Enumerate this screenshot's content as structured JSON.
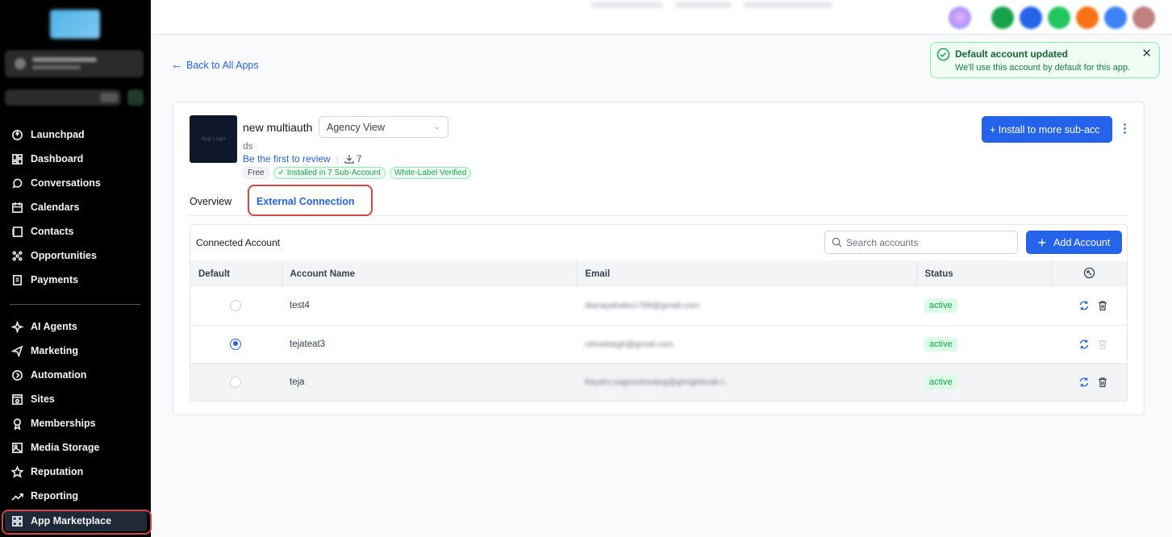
{
  "sidebar": {
    "nav_top": [
      {
        "label": "Launchpad",
        "icon": "rocket-icon"
      },
      {
        "label": "Dashboard",
        "icon": "dashboard-icon"
      },
      {
        "label": "Conversations",
        "icon": "chat-icon"
      },
      {
        "label": "Calendars",
        "icon": "calendar-icon"
      },
      {
        "label": "Contacts",
        "icon": "contacts-icon"
      },
      {
        "label": "Opportunities",
        "icon": "opportunities-icon"
      },
      {
        "label": "Payments",
        "icon": "payments-icon"
      }
    ],
    "nav_bottom": [
      {
        "label": "AI Agents",
        "icon": "sparkle-icon"
      },
      {
        "label": "Marketing",
        "icon": "send-icon"
      },
      {
        "label": "Automation",
        "icon": "automation-icon"
      },
      {
        "label": "Sites",
        "icon": "sites-icon"
      },
      {
        "label": "Memberships",
        "icon": "award-icon"
      },
      {
        "label": "Media Storage",
        "icon": "image-icon"
      },
      {
        "label": "Reputation",
        "icon": "star-icon"
      },
      {
        "label": "Reporting",
        "icon": "trend-icon"
      },
      {
        "label": "App Marketplace",
        "icon": "grid-icon"
      }
    ],
    "active": "App Marketplace"
  },
  "toast": {
    "title": "Default account updated",
    "message": "We'll use this account by default for this app.",
    "close": "✕"
  },
  "back_link": "Back to All Apps",
  "app": {
    "logo_text": "App Logo",
    "name": "new multiauth",
    "view_select": "Agency View",
    "description": "ds",
    "review_link": "Be the first to review",
    "downloads": "7",
    "badges": {
      "free": "Free",
      "installed": "✓ Installed in 7 Sub-Account",
      "whitelabel": "White-Label Verified"
    },
    "install_button": "+ Install to more sub-acc"
  },
  "tabs": {
    "overview": "Overview",
    "external": "External Connection"
  },
  "connections": {
    "title": "Connected Account",
    "search_placeholder": "Search accounts",
    "add_button": "Add Account",
    "columns": {
      "default": "Default",
      "name": "Account Name",
      "email": "Email",
      "status": "Status"
    },
    "rows": [
      {
        "name": "test4",
        "email": "dianayahatecr789@gmail.com",
        "status": "active",
        "default": false
      },
      {
        "name": "tejateat3",
        "email": "ctimatepgh@gmail.com",
        "status": "active",
        "default": true
      },
      {
        "name": "teja",
        "email": "thiyahv.sagenshwateg@ghrighlerab.l...",
        "status": "active",
        "default": false
      }
    ]
  },
  "colors": {
    "accent": "#2563eb",
    "success": "#16a34a",
    "highlight": "#d64541"
  }
}
